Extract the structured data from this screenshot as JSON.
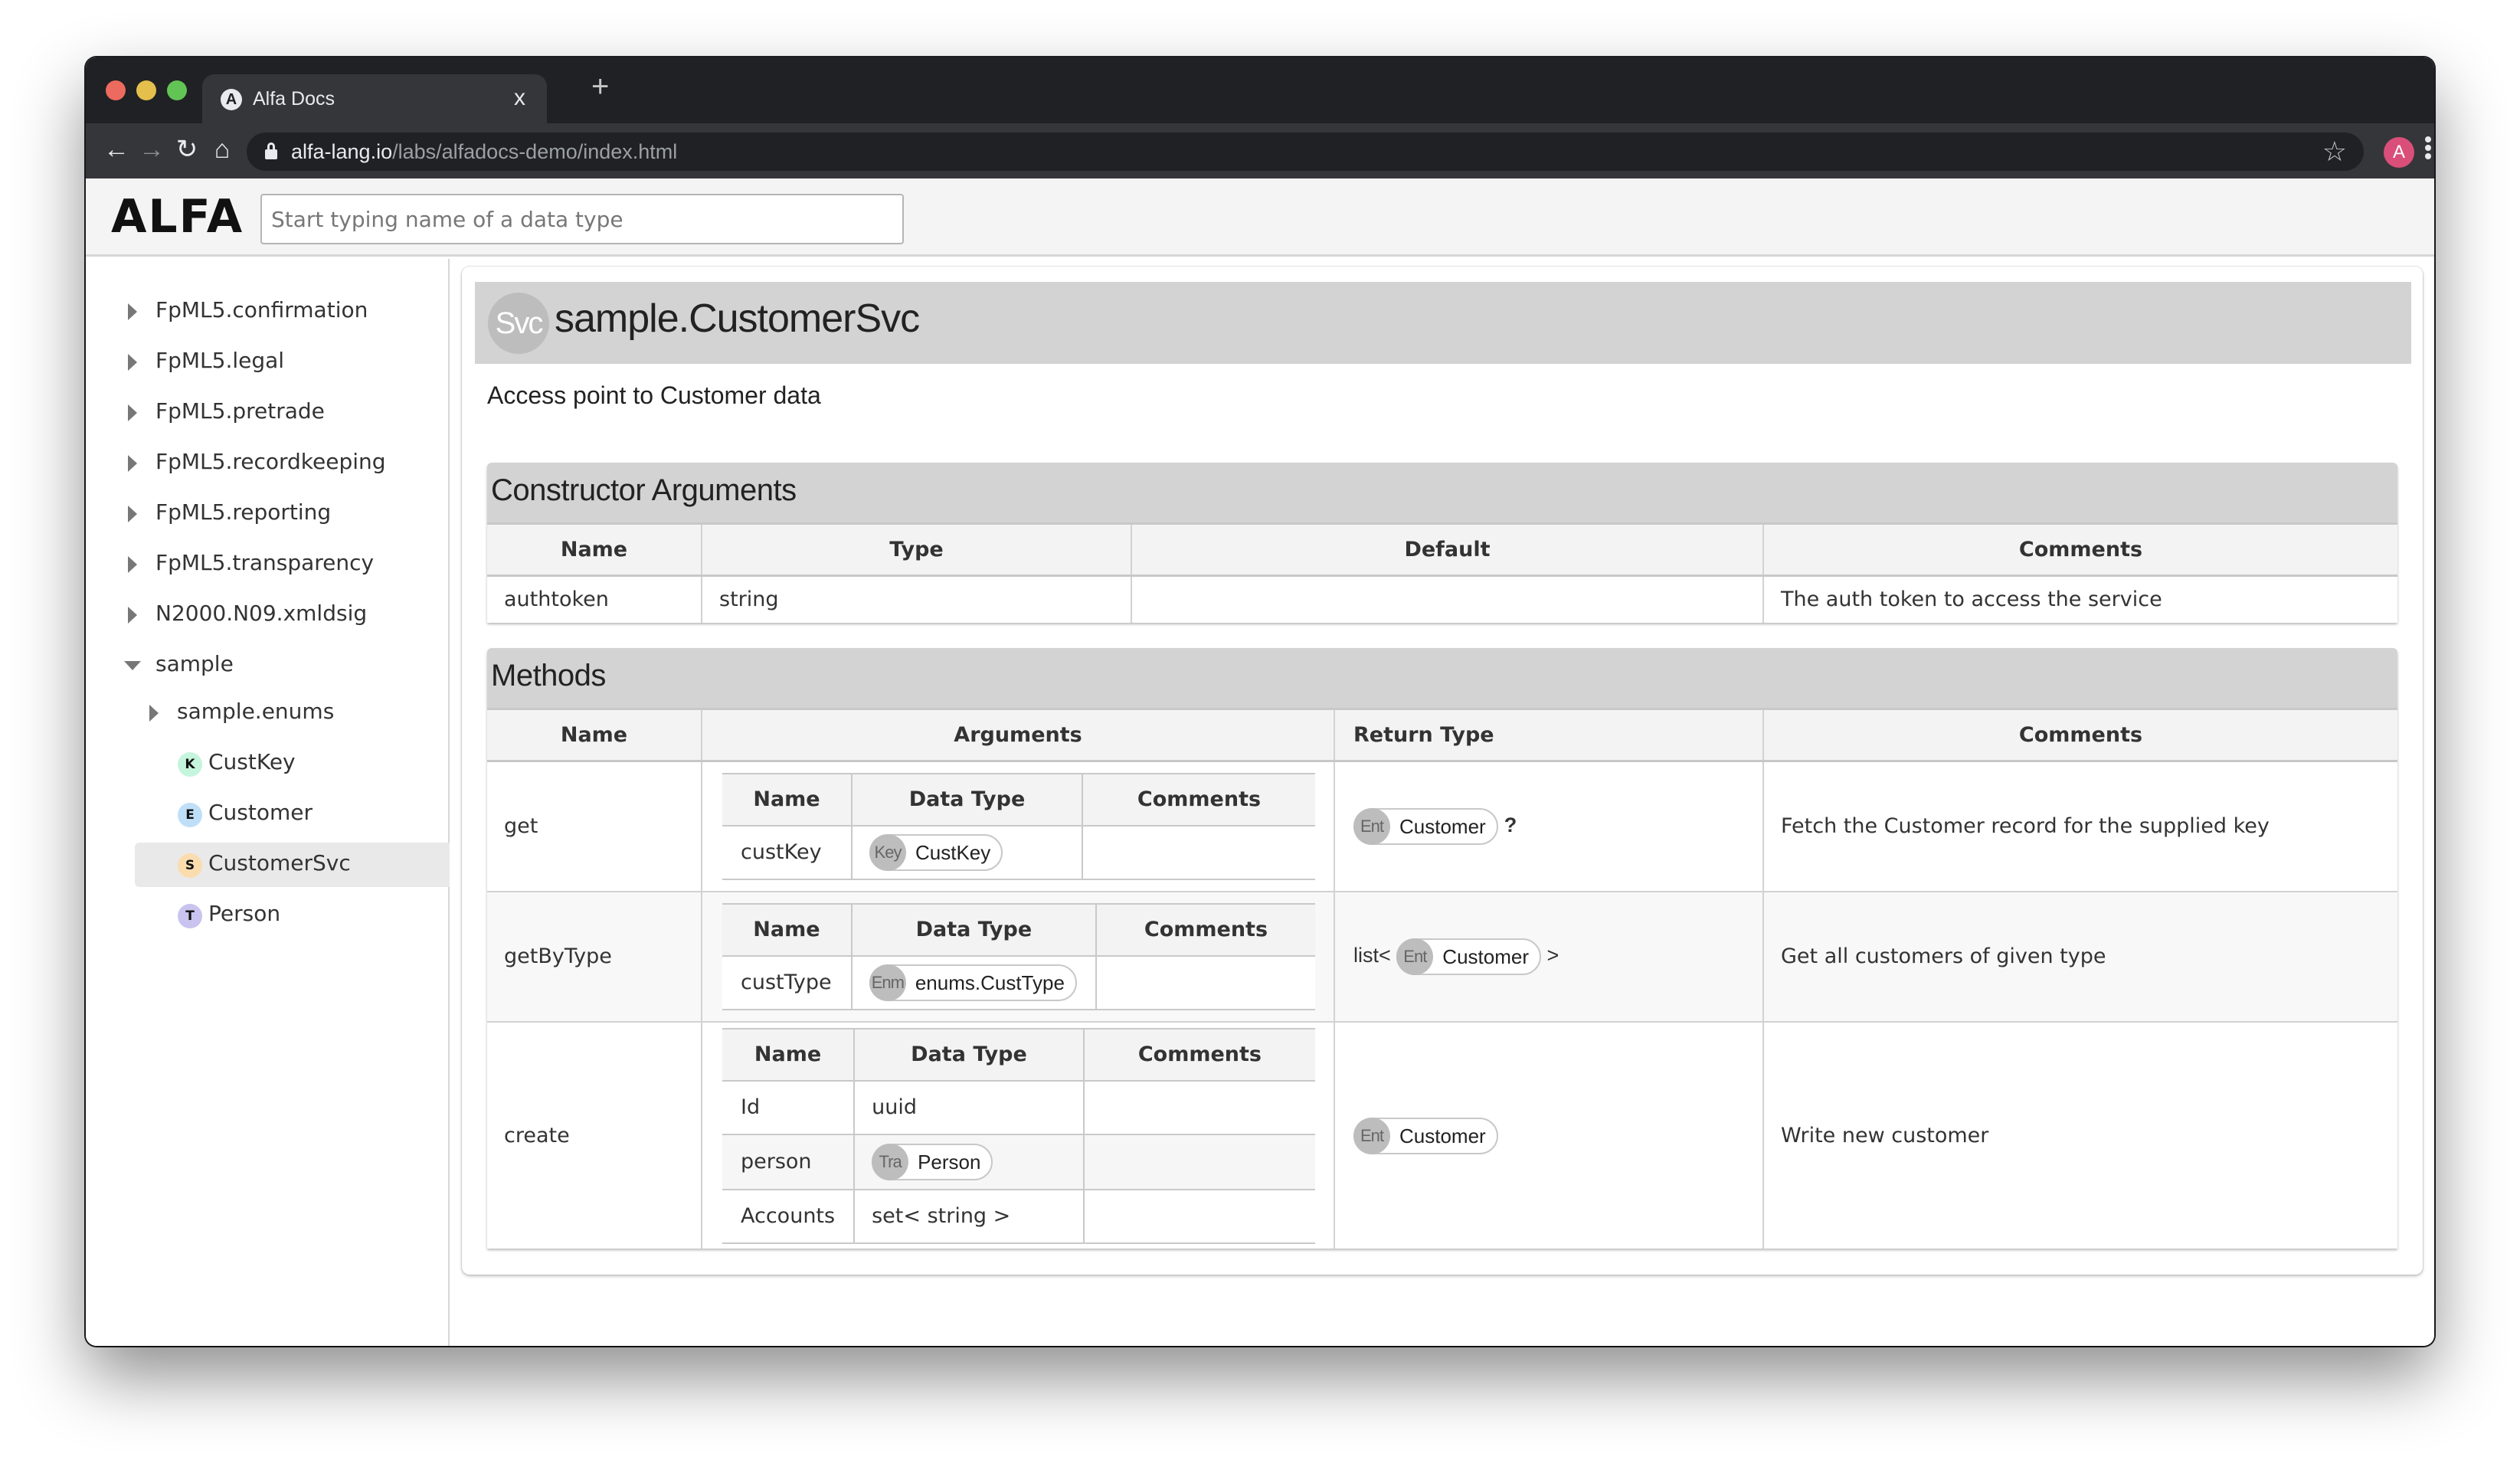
{
  "browser": {
    "tab_title": "Alfa Docs",
    "tab_close": "x",
    "new_tab": "+",
    "url_host": "alfa-lang.io",
    "url_path": "/labs/alfadocs-demo/index.html",
    "profile_initial": "A",
    "nav": {
      "back": "←",
      "forward": "→",
      "reload": "↻",
      "home": "⌂",
      "bookmark": "☆"
    },
    "favicon_letter": "A"
  },
  "app": {
    "logo": "ALFA",
    "search_placeholder": "Start typing name of a data type"
  },
  "sidebar": {
    "items": [
      {
        "label": "FpML5.confirmation",
        "type": "package",
        "expanded": false
      },
      {
        "label": "FpML5.legal",
        "type": "package",
        "expanded": false
      },
      {
        "label": "FpML5.pretrade",
        "type": "package",
        "expanded": false
      },
      {
        "label": "FpML5.recordkeeping",
        "type": "package",
        "expanded": false
      },
      {
        "label": "FpML5.reporting",
        "type": "package",
        "expanded": false
      },
      {
        "label": "FpML5.transparency",
        "type": "package",
        "expanded": false
      },
      {
        "label": "N2000.N09.xmldsig",
        "type": "package",
        "expanded": false
      },
      {
        "label": "sample",
        "type": "package",
        "expanded": true
      },
      {
        "label": "sample.enums",
        "type": "package",
        "expanded": false
      },
      {
        "label": "CustKey",
        "badge": "K",
        "badge_color": "#c5f5dc"
      },
      {
        "label": "Customer",
        "badge": "E",
        "badge_color": "#bfdff8"
      },
      {
        "label": "CustomerSvc",
        "badge": "S",
        "badge_color": "#fbdcae",
        "selected": true
      },
      {
        "label": "Person",
        "badge": "T",
        "badge_color": "#c9c3ef"
      }
    ]
  },
  "main": {
    "kind_badge": "Svc",
    "title": "sample.CustomerSvc",
    "description": "Access point to Customer data",
    "constructor": {
      "title": "Constructor Arguments",
      "columns": [
        "Name",
        "Type",
        "Default",
        "Comments"
      ],
      "rows": [
        {
          "name": "authtoken",
          "type": "string",
          "default": "",
          "comments": "The auth token to access the service"
        }
      ]
    },
    "methods": {
      "title": "Methods",
      "columns": [
        "Name",
        "Arguments",
        "Return Type",
        "Comments"
      ],
      "arg_columns": [
        "Name",
        "Data Type",
        "Comments"
      ],
      "rows": [
        {
          "name": "get",
          "args": [
            {
              "name": "custKey",
              "kind": "Key",
              "type": "CustKey",
              "comments": ""
            }
          ],
          "return": {
            "prefix": "",
            "kind": "Ent",
            "type": "Customer",
            "suffix": "?"
          },
          "comments": "Fetch the Customer record for the supplied key"
        },
        {
          "name": "getByType",
          "args": [
            {
              "name": "custType",
              "kind": "Enm",
              "type": "enums.CustType",
              "comments": ""
            }
          ],
          "return": {
            "prefix": "list<",
            "kind": "Ent",
            "type": "Customer",
            "suffix": ">"
          },
          "comments": "Get all customers of given type"
        },
        {
          "name": "create",
          "args": [
            {
              "name": "Id",
              "kind": "",
              "type": "uuid",
              "comments": ""
            },
            {
              "name": "person",
              "kind": "Tra",
              "type": "Person",
              "comments": ""
            },
            {
              "name": "Accounts",
              "kind": "",
              "type": "set< string >",
              "comments": ""
            }
          ],
          "return": {
            "prefix": "",
            "kind": "Ent",
            "type": "Customer",
            "suffix": ""
          },
          "comments": "Write new customer"
        }
      ]
    }
  }
}
